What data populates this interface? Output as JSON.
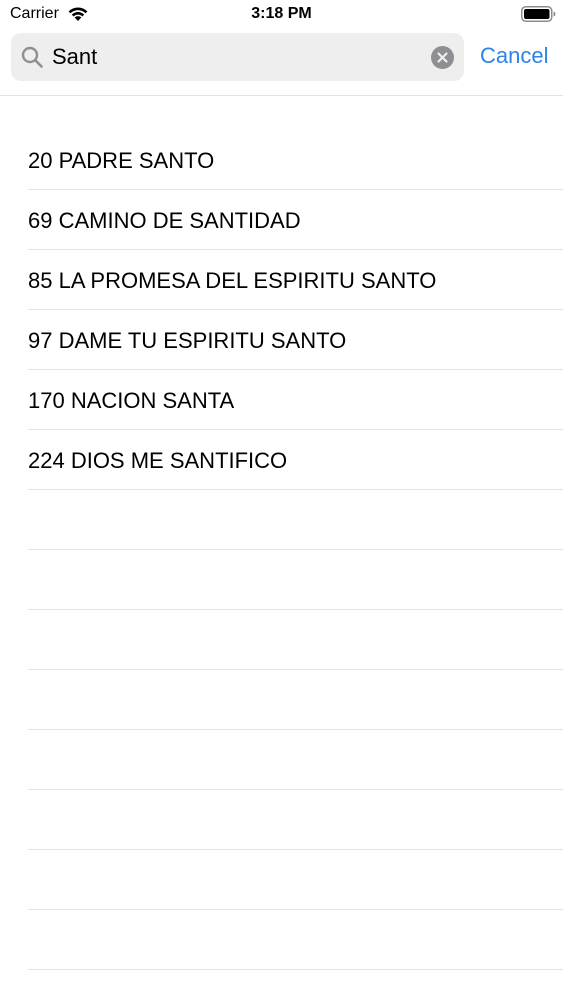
{
  "status_bar": {
    "carrier": "Carrier",
    "time": "3:18 PM"
  },
  "search": {
    "query": "Sant",
    "cancel_label": "Cancel"
  },
  "results": [
    {
      "label": "20 PADRE SANTO"
    },
    {
      "label": "69 CAMINO DE SANTIDAD"
    },
    {
      "label": "85 LA PROMESA DEL ESPIRITU SANTO"
    },
    {
      "label": "97 DAME TU ESPIRITU SANTO"
    },
    {
      "label": "170 NACION SANTA"
    },
    {
      "label": "224 DIOS ME SANTIFICO"
    }
  ],
  "colors": {
    "accent": "#2c84e6",
    "search_field_bg": "#eeeeef",
    "separator": "#e2e2e4",
    "icon_gray": "#8e8e93"
  },
  "icons": {
    "wifi": "wifi-icon",
    "battery": "battery-icon",
    "search": "search-icon",
    "clear": "clear-icon"
  }
}
